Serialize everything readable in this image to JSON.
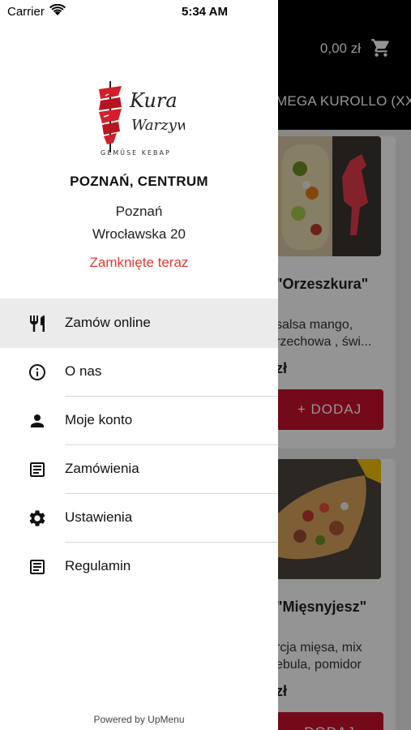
{
  "status_bar": {
    "carrier": "Carrier",
    "time": "5:34 AM"
  },
  "background": {
    "cart_total": "0,00 zł",
    "category_title": "MEGA KUROLLO (XX",
    "cards": [
      {
        "name": "\"Orzeszkura\"",
        "desc_line1": "salsa mango,",
        "desc_line2": "rzechowa , świ...",
        "price": "zł",
        "add_label": "+ DODAJ"
      },
      {
        "name": "\"Mięsnyjesz\"",
        "desc_line1": "rcja mięsa, mix",
        "desc_line2": "ebula, pomidor",
        "price": "zł",
        "add_label": "DODAJ"
      }
    ]
  },
  "drawer": {
    "logo": {
      "text1": "Kura",
      "text2": "Warzyw",
      "tagline": "GEMÜSE KEBAP"
    },
    "restaurant_name": "POZNAŃ, CENTRUM",
    "city": "Poznań",
    "street": "Wrocławska 20",
    "status": "Zamknięte teraz",
    "menu": [
      {
        "label": "Zamów online",
        "icon": "cutlery-icon"
      },
      {
        "label": "O nas",
        "icon": "info-icon"
      },
      {
        "label": "Moje konto",
        "icon": "person-icon"
      },
      {
        "label": "Zamówienia",
        "icon": "document-icon"
      },
      {
        "label": "Ustawienia",
        "icon": "gear-icon"
      },
      {
        "label": "Regulamin",
        "icon": "document-icon"
      }
    ],
    "footer": "Powered by UpMenu"
  },
  "colors": {
    "brand_red": "#c8102e",
    "closed_status": "#e53935",
    "active_item_bg": "#ebebeb"
  }
}
